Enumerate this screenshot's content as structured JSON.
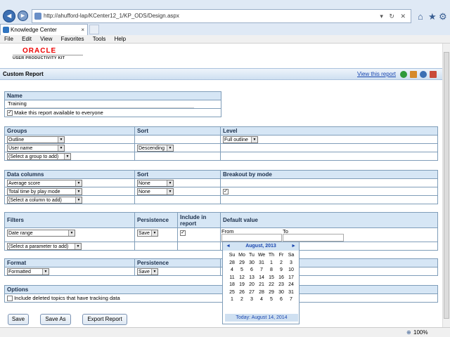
{
  "browser": {
    "url": "http://ahufford-lap/KCenter12_1/KP_ODS/Design.aspx",
    "tab_title": "Knowledge Center",
    "tab_close": "×",
    "menus": [
      "File",
      "Edit",
      "View",
      "Favorites",
      "Tools",
      "Help"
    ],
    "zoom": "100%"
  },
  "logo": {
    "brand": "ORACLE",
    "product": "USER PRODUCTIVITY KIT"
  },
  "page": {
    "title": "Custom Report",
    "view_link": "View this report"
  },
  "name_section": {
    "header": "Name",
    "value": "Training",
    "available_label": "Make this report available to everyone",
    "available_checked": "✓"
  },
  "groups_section": {
    "headers": [
      "Groups",
      "Sort",
      "Level"
    ],
    "group1": "Outline",
    "group2": "User name",
    "group_add": "(Select a group to add)",
    "sort2": "Descending",
    "level1": "Full outline"
  },
  "data_section": {
    "headers": [
      "Data columns",
      "Sort",
      "Breakout by mode"
    ],
    "col1": "Average score",
    "col2": "Total time by play mode",
    "col_add": "(Select a column to add)",
    "sort1": "None",
    "sort2": "None",
    "breakout_checked": "✓"
  },
  "filters_section": {
    "headers": [
      "Filters",
      "Persistence",
      "Include in report",
      "Default value"
    ],
    "filter1": "Date range",
    "persistence1": "Save",
    "include_checked": "✓",
    "from_label": "From",
    "to_label": "To",
    "param_add": "(Select a parameter to add)"
  },
  "format_section": {
    "headers": [
      "Format",
      "Persistence"
    ],
    "format": "Formatted",
    "persistence": "Save"
  },
  "options_section": {
    "header": "Options",
    "deleted_label": "Include deleted topics that have tracking data"
  },
  "buttons": {
    "save": "Save",
    "save_as": "Save As",
    "export": "Export Report"
  },
  "calendar": {
    "month": "August, 2013",
    "prev": "◄",
    "next": "►",
    "weekdays": [
      "Su",
      "Mo",
      "Tu",
      "We",
      "Th",
      "Fr",
      "Sa"
    ],
    "weeks": [
      [
        "28",
        "29",
        "30",
        "31",
        "1",
        "2",
        "3"
      ],
      [
        "4",
        "5",
        "6",
        "7",
        "8",
        "9",
        "10"
      ],
      [
        "11",
        "12",
        "13",
        "14",
        "15",
        "16",
        "17"
      ],
      [
        "18",
        "19",
        "20",
        "21",
        "22",
        "23",
        "24"
      ],
      [
        "25",
        "26",
        "27",
        "28",
        "29",
        "30",
        "31"
      ],
      [
        "1",
        "2",
        "3",
        "4",
        "5",
        "6",
        "7"
      ]
    ],
    "today": "Today: August 14, 2014"
  }
}
